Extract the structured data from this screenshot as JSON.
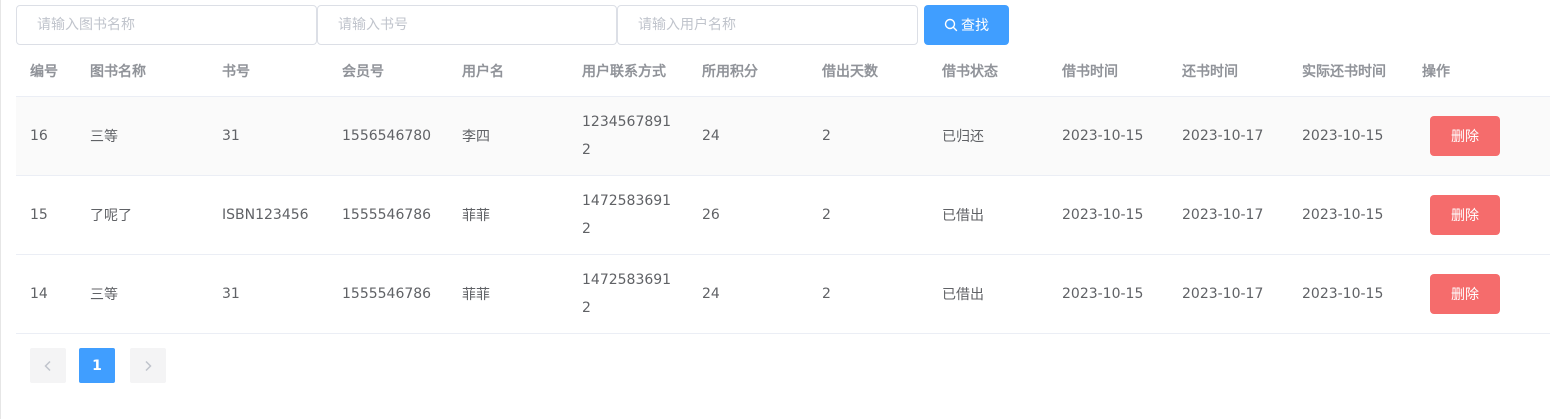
{
  "search": {
    "book_placeholder": "请输入图书名称",
    "book_no_placeholder": "请输入书号",
    "user_placeholder": "请输入用户名称",
    "button_label": "查找",
    "button_icon": "search-icon",
    "button_color": "#409eff"
  },
  "table": {
    "columns": [
      "编号",
      "图书名称",
      "书号",
      "会员号",
      "用户名",
      "用户联系方式",
      "所用积分",
      "借出天数",
      "借书状态",
      "借书时间",
      "还书时间",
      "实际还书时间",
      "操作"
    ],
    "rows": [
      {
        "id": "16",
        "book_name": "三等",
        "book_no": "31",
        "member_no": "1556546780",
        "username": "李四",
        "phone": "12345678912",
        "points": "24",
        "days": "2",
        "status": "已归还",
        "borrow_time": "2023-10-15",
        "return_time": "2023-10-17",
        "actual_return_time": "2023-10-15",
        "action": "删除"
      },
      {
        "id": "15",
        "book_name": "了呢了",
        "book_no": "ISBN123456",
        "member_no": "1555546786",
        "username": "菲菲",
        "phone": "14725836912",
        "points": "26",
        "days": "2",
        "status": "已借出",
        "borrow_time": "2023-10-15",
        "return_time": "2023-10-17",
        "actual_return_time": "2023-10-15",
        "action": "删除"
      },
      {
        "id": "14",
        "book_name": "三等",
        "book_no": "31",
        "member_no": "1555546786",
        "username": "菲菲",
        "phone": "14725836912",
        "points": "24",
        "days": "2",
        "status": "已借出",
        "borrow_time": "2023-10-15",
        "return_time": "2023-10-17",
        "actual_return_time": "2023-10-15",
        "action": "删除"
      }
    ],
    "delete_color": "#f56c6c"
  },
  "pagination": {
    "prev_icon": "chevron-left-icon",
    "next_icon": "chevron-right-icon",
    "current_page": "1"
  }
}
